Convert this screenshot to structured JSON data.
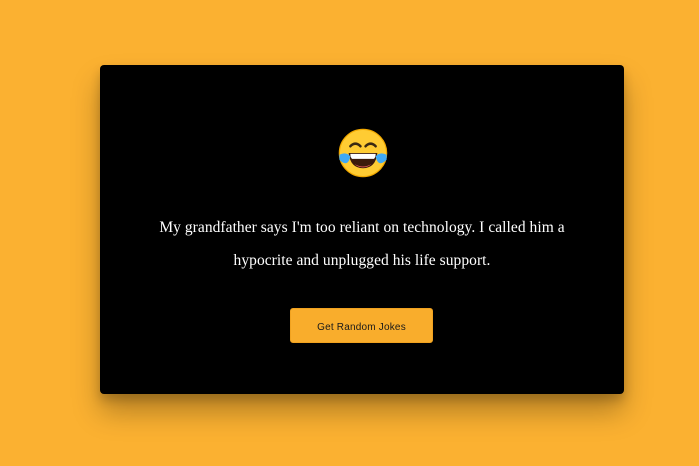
{
  "joke": {
    "emoji_icon": "face-with-tears-of-joy-icon",
    "text": "My grandfather says I'm too reliant on technology. I called him a hypocrite and unplugged his life support."
  },
  "actions": {
    "get_jokes_label": "Get Random Jokes"
  },
  "colors": {
    "background": "#fbb131",
    "card": "#000000",
    "button": "#f9ad2c",
    "text": "#ffffff"
  }
}
